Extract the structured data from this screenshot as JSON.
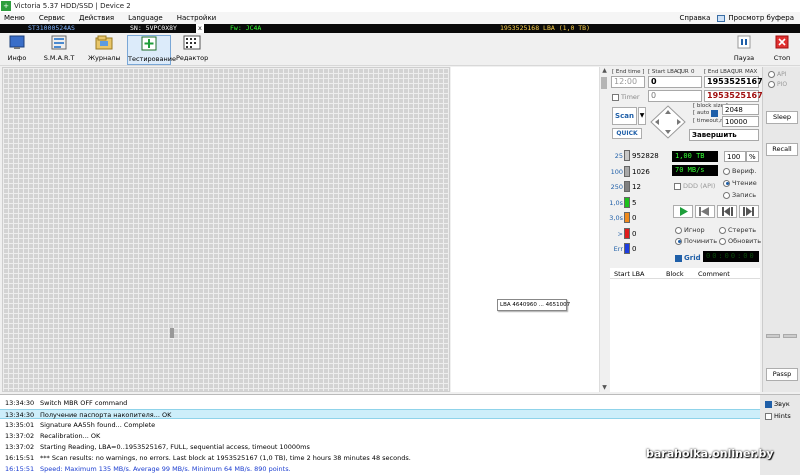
{
  "window": {
    "title": "Victoria 5.37 HDD/SSD | Device 2"
  },
  "menu": {
    "items": [
      "Меню",
      "Сервис",
      "Действия",
      "Language",
      "Настройки"
    ],
    "help": "Справка",
    "buffer_view": "Просмотр буфера"
  },
  "drive": {
    "model": "ST31000524AS",
    "serial": "SN: 5VPC0X8Y",
    "close": "x",
    "firmware": "Fw: JC4A",
    "capacity": "1953525168 LBA (1,0 TB)"
  },
  "toolbar": {
    "info": "Инфо",
    "smart": "S.M.A.R.T",
    "logs": "Журналы",
    "test": "Тестирование",
    "editor": "Редактор",
    "pause": "Пауза",
    "stop": "Стоп"
  },
  "scan": {
    "tooltip": "LBA  4640960 ... 4651007",
    "end_time_label": "[ End time ]",
    "start_lba_label": "[ Start LBA ]",
    "cur_label": "CUR",
    "zero_label": "0",
    "end_lba_label": "[ End LBA ]",
    "cur2_label": "CUR",
    "max_label": "MAX",
    "time_value": "12:00",
    "start_lba_value": "0",
    "end_lba_value": "1953525167",
    "timer_label": "Timer",
    "timer_value": "0",
    "cur_lba_value": "1953525167",
    "block_size_label": "[ block size ]",
    "auto_label": "[ auto ]",
    "timeout_label": "[ timeout,ms ]",
    "block_size_value": "2048",
    "timeout_value": "10000",
    "scan_button": "Scan",
    "quick_button": "QUICK",
    "finish_select": "Завершить"
  },
  "stats": {
    "rows": [
      {
        "label": "25",
        "value": "952828",
        "color": "#c8c8c8"
      },
      {
        "label": "100",
        "value": "1026",
        "color": "#a8a8a8"
      },
      {
        "label": "250",
        "value": "12",
        "color": "#808080"
      },
      {
        "label": "1,0s",
        "value": "5",
        "color": "#1cc21c"
      },
      {
        "label": "3,0s",
        "value": "0",
        "color": "#f08a1c"
      },
      {
        "label": ">",
        "value": "0",
        "color": "#e01c1c"
      },
      {
        "label": "Err",
        "value": "0",
        "color": "#1c3ce0"
      }
    ],
    "size": "1,00 TB",
    "percent": "100",
    "percent_unit": "%",
    "speed": "70 MB/s",
    "verify": "Вериф.",
    "read": "Чтение",
    "write": "Запись",
    "ddd": "DDD (API)",
    "ignore": "Игнор",
    "erase": "Стереть",
    "remap": "Починить",
    "refresh": "Обновить",
    "grid": "Grid",
    "grid_time": "00:00:00"
  },
  "table": {
    "start_lba": "Start LBA",
    "block": "Block",
    "comment": "Comment"
  },
  "side": {
    "api": "API",
    "pio": "PIO",
    "sleep": "Sleep",
    "recall": "Recall",
    "passp": "Passp"
  },
  "log": {
    "rows": [
      {
        "time": "13:34:30",
        "msg": "Switch MBR OFF command",
        "color": "#000000",
        "bg": "#ffffff"
      },
      {
        "time": "13:34:30",
        "msg": "Получение паспорта накопителя... OK",
        "color": "#000000",
        "bg": "#cdeefa"
      },
      {
        "time": "13:35:01",
        "msg": "Signature AA55h found... Complete",
        "color": "#000000",
        "bg": "#ffffff"
      },
      {
        "time": "13:37:02",
        "msg": "Recalibration... OK",
        "color": "#000000",
        "bg": "#ffffff"
      },
      {
        "time": "13:37:02",
        "msg": "Starting Reading, LBA=0..1953525167, FULL, sequential access, timeout 10000ms",
        "color": "#000000",
        "bg": "#ffffff"
      },
      {
        "time": "16:15:51",
        "msg": "*** Scan results: no warnings, no errors. Last block at 1953525167 (1,0 TB), time 2 hours 38 minutes 48 seconds.",
        "color": "#000000",
        "bg": "#ffffff"
      },
      {
        "time": "16:15:51",
        "msg": "Speed: Maximum 135 MB/s. Average 99 MB/s. Minimum 64 MB/s. 890 points.",
        "color": "#1a3cd0",
        "bg": "#ffffff"
      }
    ],
    "sound": "Звук",
    "hints": "Hints"
  },
  "watermark": "baraholka.onliner.by",
  "colors": {
    "accent": "#1f5fa8",
    "green_led": "#33ff33",
    "selected_row": "#cdeefa"
  }
}
